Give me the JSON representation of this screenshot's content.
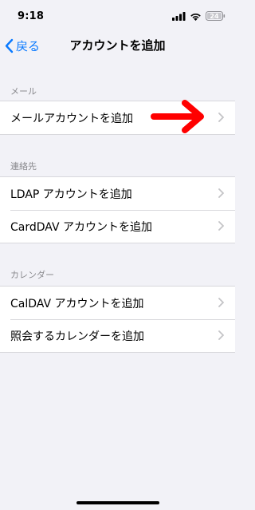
{
  "status_bar": {
    "time": "9:18",
    "battery_level": "24",
    "icons": [
      "signal-icon",
      "wifi-icon",
      "battery-icon"
    ]
  },
  "nav": {
    "back_label": "戻る",
    "title": "アカウントを追加"
  },
  "sections": [
    {
      "header": "メール",
      "rows": [
        {
          "label": "メールアカウントを追加"
        }
      ]
    },
    {
      "header": "連絡先",
      "rows": [
        {
          "label": "LDAP アカウントを追加"
        },
        {
          "label": "CardDAV アカウントを追加"
        }
      ]
    },
    {
      "header": "カレンダー",
      "rows": [
        {
          "label": "CalDAV アカウントを追加"
        },
        {
          "label": "照会するカレンダーを追加"
        }
      ]
    }
  ],
  "colors": {
    "background": "#f2f2f7",
    "accent": "#0a7aff",
    "annotation_arrow": "#ff0000",
    "section_header": "#8a8a8e",
    "chevron": "#c4c4c7"
  }
}
